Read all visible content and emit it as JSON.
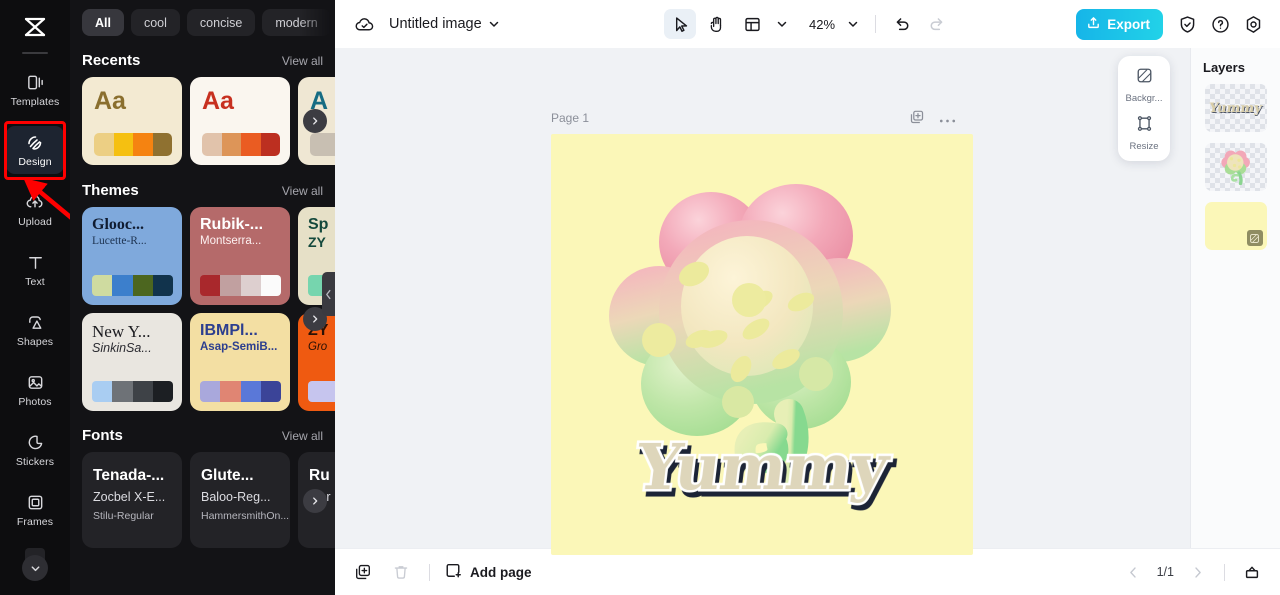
{
  "rail": {
    "logo_icon": "capcut-logo-icon",
    "items": [
      {
        "label": "Templates",
        "icon": "templates-icon",
        "active": false
      },
      {
        "label": "Design",
        "icon": "design-icon",
        "active": true
      },
      {
        "label": "Upload",
        "icon": "upload-icon",
        "active": false
      },
      {
        "label": "Text",
        "icon": "text-icon",
        "active": false
      },
      {
        "label": "Shapes",
        "icon": "shapes-icon",
        "active": false
      },
      {
        "label": "Photos",
        "icon": "photos-icon",
        "active": false
      },
      {
        "label": "Stickers",
        "icon": "stickers-icon",
        "active": false
      },
      {
        "label": "Frames",
        "icon": "frames-icon",
        "active": false
      }
    ],
    "more_icon": "chevron-down-icon"
  },
  "panel": {
    "chips": [
      {
        "label": "All",
        "active": true
      },
      {
        "label": "cool",
        "active": false
      },
      {
        "label": "concise",
        "active": false
      },
      {
        "label": "modern",
        "active": false
      }
    ],
    "chip_expand_icon": "chevron-down-icon",
    "collapse_handle_icon": "chevron-left-icon",
    "sections": {
      "recents": {
        "title": "Recents",
        "view_all": "View all",
        "cards": [
          {
            "sample": "Aa",
            "bg": "#f3ead2",
            "fg": "#8a6f2e",
            "swatches": [
              "#eccf84",
              "#f5c011",
              "#f58311",
              "#8f7130"
            ]
          },
          {
            "sample": "Aa",
            "bg": "#faf6ef",
            "fg": "#c7301f",
            "swatches": [
              "#e1c3ab",
              "#dd9558",
              "#ea5c22",
              "#bc2f20"
            ]
          },
          {
            "sample": "A",
            "bg": "#efe7d3",
            "fg": "#166c83",
            "swatches": [
              "#c8bfb2",
              "#c8bfb2",
              "#c8bfb2",
              "#c8bfb2"
            ]
          }
        ]
      },
      "themes": {
        "title": "Themes",
        "view_all": "View all",
        "cards": [
          {
            "t1": "Glooc...",
            "t2": "Lucette-R...",
            "bg": "#7fa9dc",
            "fg1": "#101c31",
            "fg2": "#1d3350",
            "serif1": true,
            "serif2": true,
            "italic2": false,
            "sw": [
              "#cfdba0",
              "#3c7fcc",
              "#4c661f",
              "#11334c"
            ]
          },
          {
            "t1": "Rubik-...",
            "t2": "Montserra...",
            "bg": "#b56a6a",
            "fg1": "#ffffff",
            "fg2": "#fdf1f1",
            "serif1": false,
            "serif2": false,
            "italic2": false,
            "sw": [
              "#a9282c",
              "#c1a0a0",
              "#ddcfcf",
              "#fbfbfb"
            ]
          },
          {
            "t1": "Sp",
            "t2": "ZY",
            "bg": "#e6e0c7",
            "fg1": "#14493c",
            "fg2": "#14493c",
            "serif1": false,
            "serif2": false,
            "italic2": false,
            "sw": [
              "#76d5ae",
              "#76d5ae",
              "#76d5ae",
              "#76d5ae"
            ]
          },
          {
            "t1": "New Y...",
            "t2": "SinkinSa...",
            "bg": "#e9e6e0",
            "fg1": "#1c1c20",
            "fg2": "#2a2a30",
            "serif1": true,
            "serif2": false,
            "italic2": true,
            "sw": [
              "#a9cdf2",
              "#6e7277",
              "#3e4247",
              "#1c1f23"
            ]
          },
          {
            "t1": "IBMPl...",
            "t2": "Asap-SemiB...",
            "bg": "#f3dfa3",
            "fg1": "#2c3e8f",
            "fg2": "#2c3e8f",
            "serif1": false,
            "serif2": false,
            "italic2": false,
            "sw": [
              "#a9a8dc",
              "#e08573",
              "#5a78d8",
              "#3b4498"
            ]
          },
          {
            "t1": "ZY",
            "t2": "Gro",
            "bg": "#ef5a11",
            "fg1": "#2a1105",
            "fg2": "#2a1105",
            "serif1": false,
            "serif2": false,
            "italic2": false,
            "sw": [
              "#c6c5ee",
              "#c6c5ee",
              "#c6c5ee",
              "#c6c5ee"
            ]
          }
        ]
      },
      "fonts": {
        "title": "Fonts",
        "view_all": "View all",
        "cards": [
          {
            "f1": "Tenada-...",
            "f2": "Zocbel X-E...",
            "f3": "Stilu-Regular"
          },
          {
            "f1": "Glute...",
            "f2": "Baloo-Reg...",
            "f3": "HammersmithOn..."
          },
          {
            "f1": "Ru",
            "f2": "Mor",
            "f3": ""
          }
        ]
      }
    },
    "next_icon": "chevron-right-icon"
  },
  "topbar": {
    "cloud_icon": "cloud-saved-icon",
    "document_title": "Untitled image",
    "title_caret_icon": "chevron-down-icon",
    "tools": [
      {
        "name": "select-tool",
        "icon": "cursor-arrow-icon",
        "selected": true
      },
      {
        "name": "hand-tool",
        "icon": "hand-icon",
        "selected": false
      },
      {
        "name": "layout-tool",
        "icon": "layout-icon",
        "selected": false
      }
    ],
    "layout_caret_icon": "chevron-down-icon",
    "zoom_value": "42%",
    "zoom_caret_icon": "chevron-down-icon",
    "undo_icon": "undo-icon",
    "redo_icon": "redo-icon",
    "export_label": "Export",
    "export_icon": "export-upload-icon",
    "export_color": "#1ec3e6",
    "right_icons": [
      {
        "name": "shield-check-icon"
      },
      {
        "name": "help-question-icon"
      },
      {
        "name": "settings-gear-icon"
      }
    ]
  },
  "canvas": {
    "page_label": "Page 1",
    "page_duplicate_icon": "duplicate-page-icon",
    "page_more_icon": "more-horizontal-icon",
    "artboard_bg": "#fbf7b8",
    "artwork_text": "Yummy",
    "float_tools": [
      {
        "label": "Backgr...",
        "icon": "background-icon"
      },
      {
        "label": "Resize",
        "icon": "resize-icon"
      }
    ]
  },
  "layers": {
    "title": "Layers",
    "items": [
      {
        "name": "layer-text-yummy",
        "type": "text",
        "transparent": true
      },
      {
        "name": "layer-flower-image",
        "type": "image",
        "transparent": true
      },
      {
        "name": "layer-background",
        "type": "background",
        "transparent": false,
        "bg": "#fbf7b8"
      }
    ]
  },
  "bottombar": {
    "duplicate_icon": "duplicate-icon",
    "delete_icon": "trash-icon",
    "add_page_label": "Add page",
    "add_page_icon": "add-page-icon",
    "prev_icon": "chevron-left-icon",
    "next_icon": "chevron-right-icon",
    "page_indicator": "1/1",
    "timeline_icon": "timeline-panel-icon"
  },
  "annotation": {
    "highlight_color": "#fe0000",
    "target": "Design"
  }
}
